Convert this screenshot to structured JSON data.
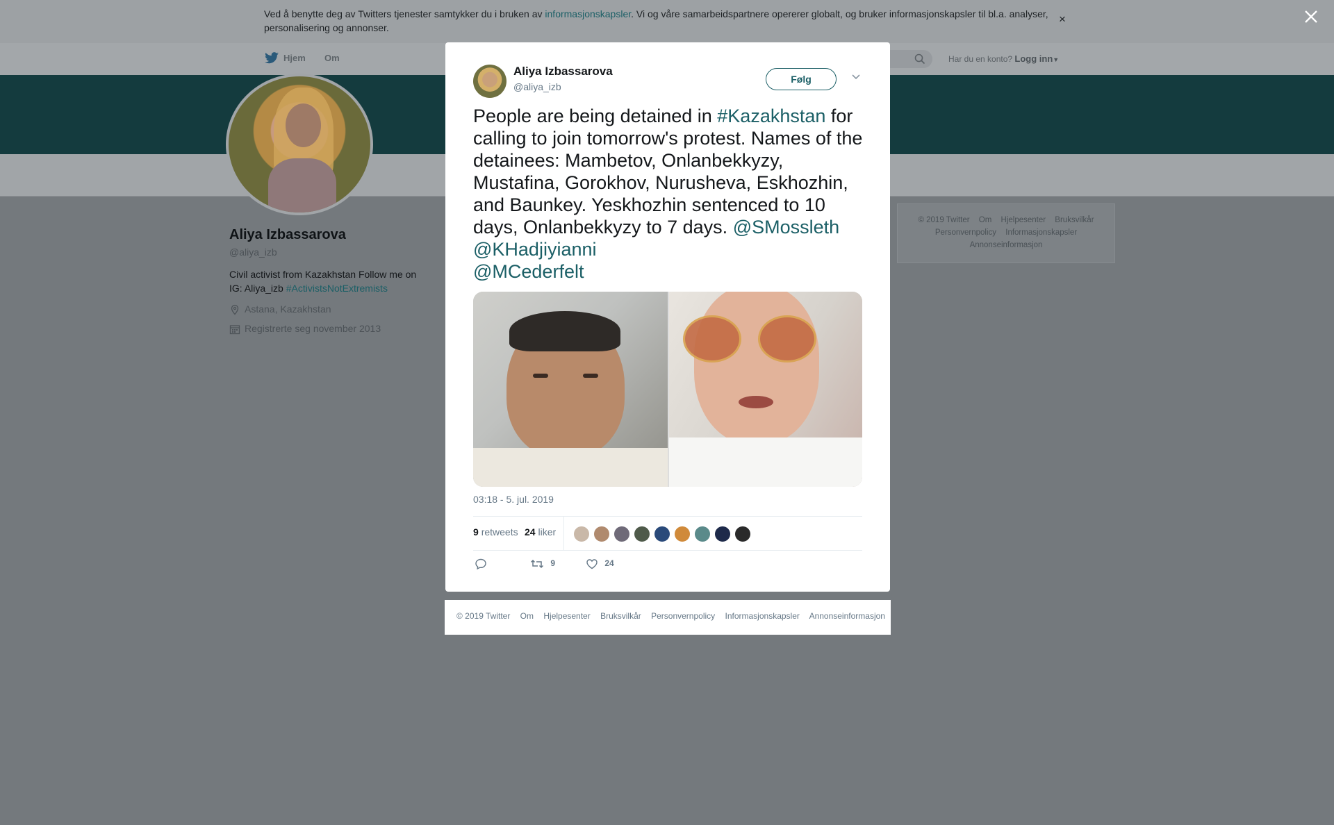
{
  "cookie_banner": {
    "text_before": "Ved å benytte deg av Twitters tjenester samtykker du i bruken av ",
    "link": "informasjonskapsler",
    "text_after": ". Vi og våre samarbeidspartnere opererer globalt, og bruker informasjonskapsler til bl.a. analyser, personalisering og annonser.",
    "close": "×"
  },
  "nav": {
    "home": "Hjem",
    "about": "Om",
    "login_prompt": "Har du en konto?",
    "login": "Logg inn"
  },
  "profile": {
    "name": "Aliya Izbassarova",
    "handle": "@aliya_izb",
    "bio_text": "Civil activist from Kazakhstan Follow me on IG: Aliya_izb ",
    "bio_hashtag": "#ActivistsNotExtremists",
    "location": "Astana, Kazakhstan",
    "joined": "Registrerte seg november 2013"
  },
  "side_footer": {
    "links": [
      "© 2019 Twitter",
      "Om",
      "Hjelpesenter",
      "Bruksvilkår",
      "Personvernpolicy",
      "Informasjonskapsler",
      "Annonseinformasjon"
    ]
  },
  "tweet": {
    "author_name": "Aliya Izbassarova",
    "author_handle": "@aliya_izb",
    "follow_label": "Følg",
    "text_1": "People are being detained in ",
    "hashtag": "#Kazakhstan",
    "text_2": " for calling to join tomorrow's protest. Names of the detainees: Mambetov, Onlanbekkyzy, Mustafina, Gorokhov, Nurusheva, Eskhozhin, and Baunkey. Yeskhozhin sentenced to 10 days, Onlanbekkyzy to 7 days. ",
    "mention_1": "@SMossleth",
    "mention_2": "@KHadjiyianni",
    "mention_3": "@MCederfelt",
    "timestamp": "03:18 - 5. jul. 2019",
    "retweets_count": "9",
    "retweets_label": "retweets",
    "likes_count": "24",
    "likes_label": "liker",
    "action_retweet_count": "9",
    "action_like_count": "24",
    "liker_colors": [
      "#c9b8a8",
      "#b08a6e",
      "#6f6a78",
      "#4f5a4a",
      "#2a4a7a",
      "#d08a3a",
      "#5a8a8a",
      "#1e2a4a",
      "#2a2a2a"
    ]
  },
  "modal_footer": {
    "links": [
      "© 2019 Twitter",
      "Om",
      "Hjelpesenter",
      "Bruksvilkår",
      "Personvernpolicy",
      "Informasjonskapsler",
      "Annonseinformasjon"
    ]
  }
}
